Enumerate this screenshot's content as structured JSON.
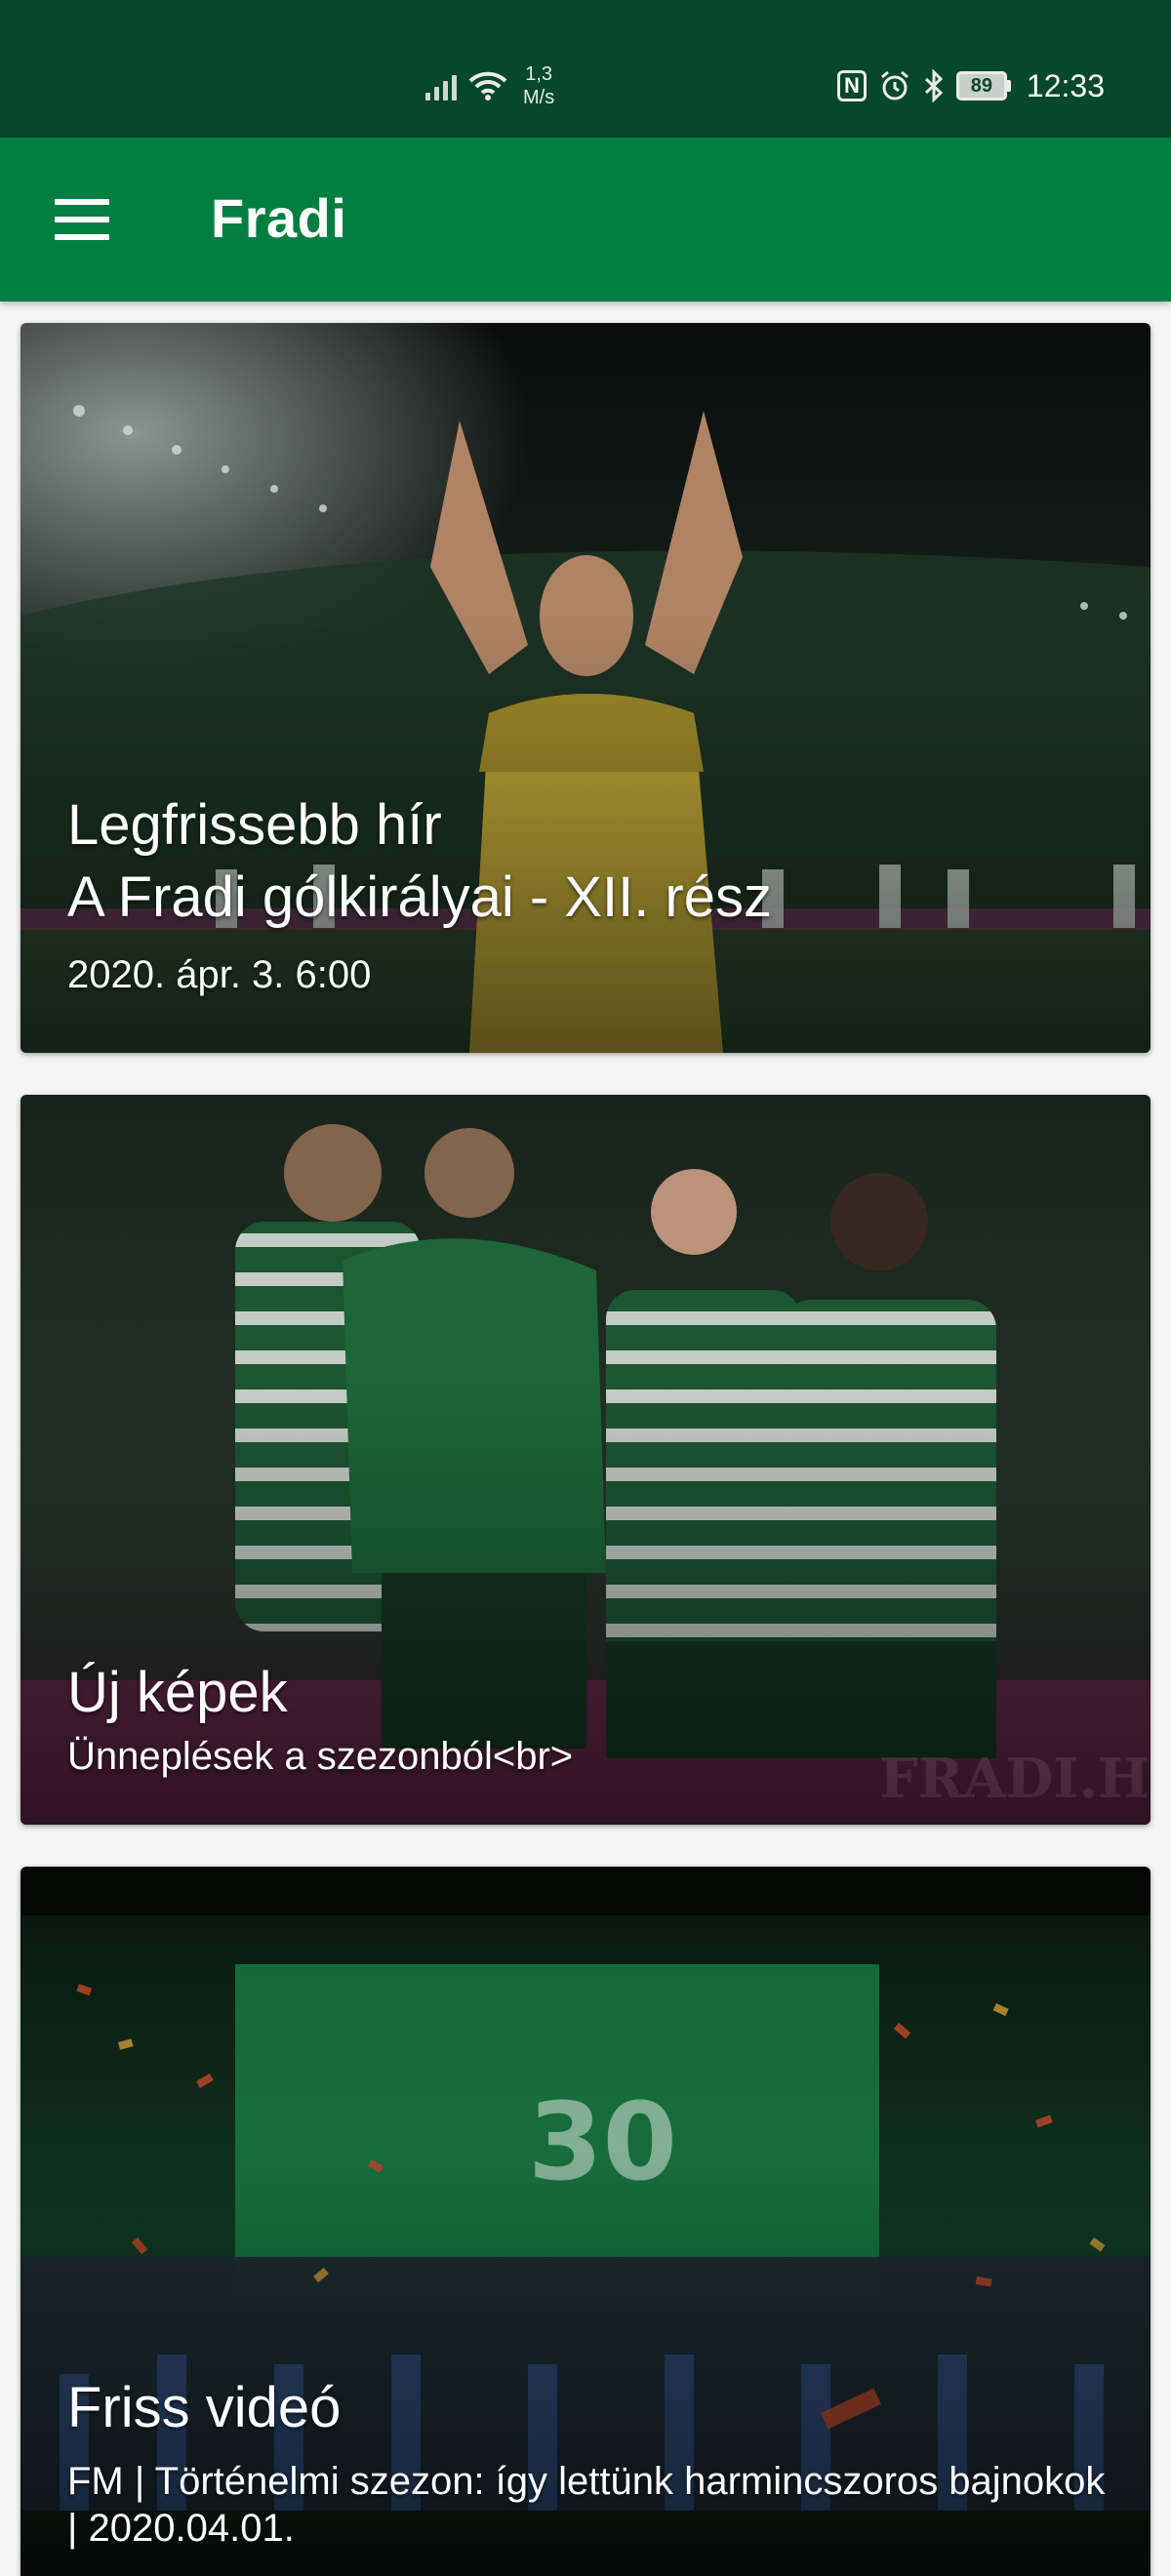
{
  "status_bar": {
    "net_speed_value": "1,3",
    "net_speed_unit": "M/s",
    "battery": "89",
    "time": "12:33"
  },
  "app_bar": {
    "title": "Fradi"
  },
  "cards": [
    {
      "heading": "Legfrissebb hír",
      "title": "A Fradi gólkirályai - XII. rész",
      "subtitle": "2020. ápr. 3. 6:00"
    },
    {
      "heading": "Új képek",
      "subtitle": "Ünneplések a szezonból<br>"
    },
    {
      "heading": "Friss videó",
      "subtitle": "FM | Történelmi szezon: így lettünk harmincszoros bajnokok | 2020.04.01."
    }
  ],
  "colors": {
    "status_bar": "#07472a",
    "app_bar": "#037e41",
    "background": "#f5f5f5"
  }
}
